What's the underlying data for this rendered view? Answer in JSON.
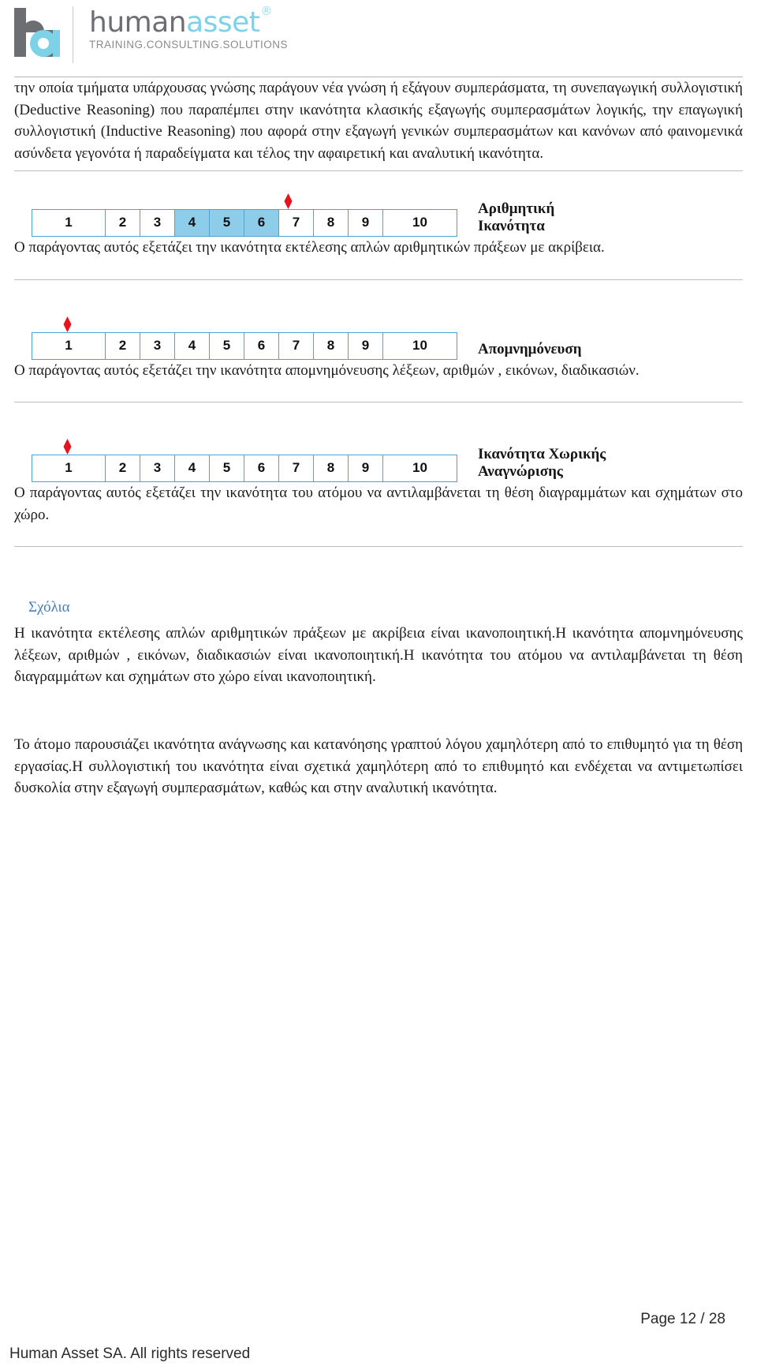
{
  "header": {
    "logo": {
      "mark_text": "ha",
      "word_first": "human",
      "word_second": "asset",
      "registered_symbol": "®",
      "tagline": "TRAINING.CONSULTING.SOLUTIONS"
    }
  },
  "intro": {
    "paragraph": "την οποία τμήματα υπάρχουσας γνώσης παράγουν νέα γνώση ή εξάγουν συμπεράσματα, τη συνεπαγωγική συλλογιστική (Deductive Reasoning) που παραπέμπει στην ικανότητα κλασικής εξαγωγής συμπερασμάτων λογικής, την επαγωγική συλλογιστική (Inductive Reasoning) που αφορά στην εξαγωγή γενικών συμπερασμάτων και κανόνων από φαινομενικά ασύνδετα γεγονότα ή παραδείγματα και τέλος την αφαιρετική και αναλυτική ικανότητα."
  },
  "scales": [
    {
      "label": "Αριθμητική\nΙκανότητα",
      "ticks": [
        "1",
        "2",
        "3",
        "4",
        "5",
        "6",
        "7",
        "8",
        "9",
        "10"
      ],
      "highlighted": [
        4,
        5,
        6
      ],
      "marker_value": 6,
      "marker_color": "#e8111c",
      "highlight_color": "#8ecdea",
      "border_color": "#4ba3d3",
      "description": "Ο παράγοντας αυτός εξετάζει την ικανότητα εκτέλεσης απλών αριθμητικών πράξεων με ακρίβεια."
    },
    {
      "label": "Απομνημόνευση",
      "ticks": [
        "1",
        "2",
        "3",
        "4",
        "5",
        "6",
        "7",
        "8",
        "9",
        "10"
      ],
      "highlighted": [],
      "marker_value": 1,
      "marker_color": "#e8111c",
      "highlight_color": "#8ecdea",
      "border_color": "#4ba3d3",
      "description": "Ο παράγοντας αυτός εξετάζει την ικανότητα απομνημόνευσης λέξεων, αριθμών , εικόνων, διαδικασιών."
    },
    {
      "label": "Ικανότητα Χωρικής\nΑναγνώρισης",
      "ticks": [
        "1",
        "2",
        "3",
        "4",
        "5",
        "6",
        "7",
        "8",
        "9",
        "10"
      ],
      "highlighted": [],
      "marker_value": 1,
      "marker_color": "#e8111c",
      "highlight_color": "#8ecdea",
      "border_color": "#4ba3d3",
      "description": "Ο παράγοντας αυτός εξετάζει την ικανότητα του ατόμου να αντιλαμβάνεται τη θέση διαγραμμάτων και σχημάτων στο χώρο."
    }
  ],
  "comments": {
    "heading": "Σχόλια",
    "heading_color": "#4a7ebb",
    "paragraph_1": "Η ικανότητα εκτέλεσης απλών αριθμητικών πράξεων με ακρίβεια είναι ικανοποιητική.Η ικανότητα απομνημόνευσης λέξεων, αριθμών , εικόνων, διαδικασιών είναι ικανοποιητική.Η ικανότητα του ατόμου να αντιλαμβάνεται τη θέση διαγραμμάτων και σχημάτων στο χώρο είναι ικανοποιητική.",
    "paragraph_2": "Το άτομο παρουσιάζει ικανότητα ανάγνωσης και κατανόησης γραπτού λόγου χαμηλότερη από το επιθυμητό για τη θέση εργασίας.Η συλλογιστική του ικανότητα είναι σχετικά χαμηλότερη από το επιθυμητό και ενδέχεται να αντιμετωπίσει δυσκολία στην εξαγωγή συμπερασμάτων, καθώς και στην αναλυτική ικανότητα."
  },
  "footer": {
    "page_label": "Page 12 / 28",
    "copyright": "Human Asset SA.  All rights reserved"
  }
}
